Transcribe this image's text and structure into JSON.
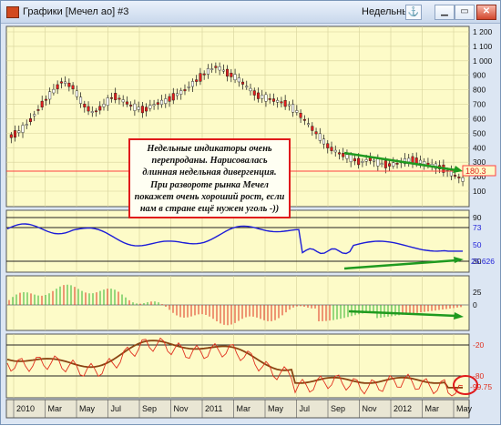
{
  "window": {
    "title": "Графики [Мечел ао] #3",
    "period": "Недельный",
    "anchor_icon": "anchor-icon",
    "buttons": {
      "minimize": "▁",
      "restore": "▭",
      "close": "✕"
    }
  },
  "colors": {
    "background": "#fdfbc8",
    "grid": "#c9c68a",
    "up_candle": "#ffffff",
    "down_candle": "#e01e1e",
    "rsi_line": "#1d1dd8",
    "trend_arrow": "#1f9a1f",
    "price_level_line": "#ff4040",
    "callout_border": "#e0191b"
  },
  "main_panel": {
    "y_labels": [
      "1 200",
      "1 100",
      "1 000",
      "900",
      "800",
      "700",
      "600",
      "500",
      "400",
      "300",
      "200",
      "100"
    ],
    "last_price": "180.3",
    "annotation": "Недельные индикаторы очень перепроданы. Нарисовалась длинная недельная дивергенция. При развороте рынка Мечел покажет очень хороший рост, если нам в стране ещё нужен уголь -))"
  },
  "rsi_panel": {
    "y_labels": [
      "90",
      "73",
      "50",
      "30"
    ],
    "last_value": "25.626"
  },
  "hist_panel": {
    "y_labels": [
      "0",
      "25"
    ]
  },
  "osc_panel": {
    "y_labels": [
      "-20",
      "-80"
    ],
    "last_value": "-99.75"
  },
  "x_axis": {
    "labels": [
      "2010",
      "Mar",
      "May",
      "Jul",
      "Sep",
      "Nov",
      "2011",
      "Mar",
      "May",
      "Jul",
      "Sep",
      "Nov",
      "2012",
      "Mar",
      "May"
    ]
  },
  "chart_data": {
    "type": "line",
    "title": "",
    "series": [
      {
        "values": [
          480,
          520,
          600,
          700,
          780,
          860,
          820,
          700,
          640,
          690,
          760,
          720,
          680,
          660,
          700,
          720,
          760,
          800,
          860,
          920,
          960,
          920,
          880,
          820,
          760,
          740,
          720,
          700,
          640,
          560,
          480,
          400,
          360,
          330,
          300,
          320,
          290,
          280,
          300,
          320,
          300,
          280,
          260,
          220,
          180
        ]
      }
    ]
  }
}
